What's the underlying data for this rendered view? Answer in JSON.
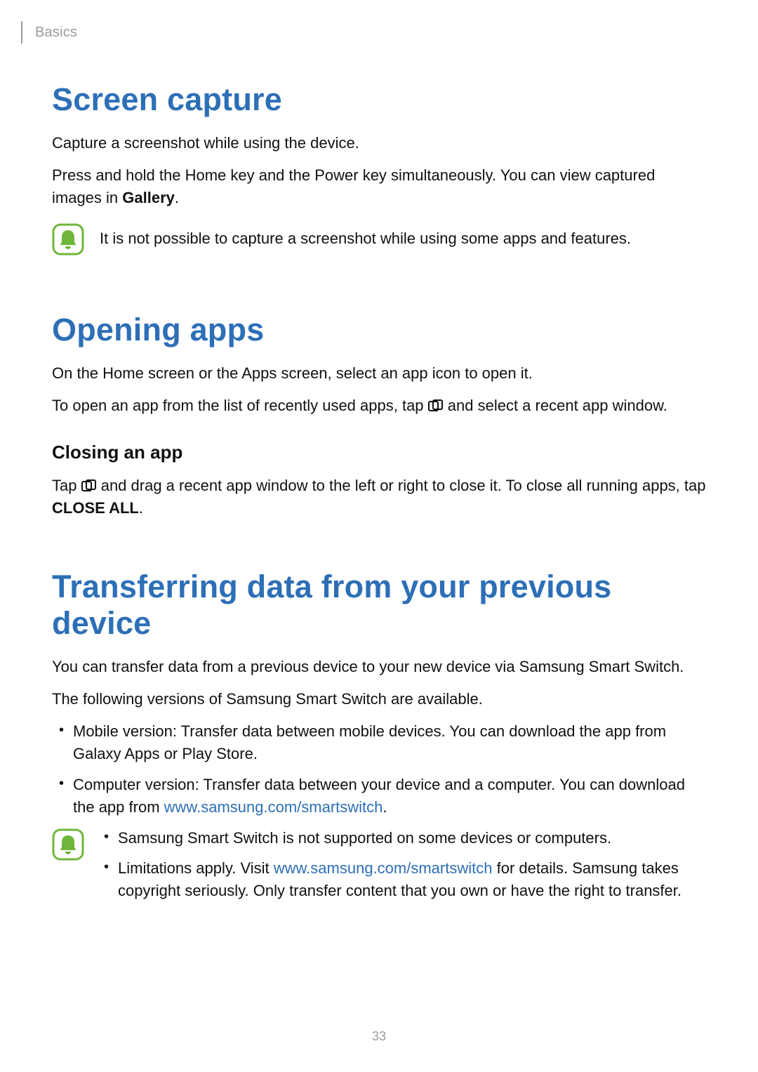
{
  "breadcrumb": "Basics",
  "page_number": "33",
  "section1": {
    "title": "Screen capture",
    "p1": "Capture a screenshot while using the device.",
    "p2_a": "Press and hold the Home key and the Power key simultaneously. You can view captured images in ",
    "p2_bold": "Gallery",
    "p2_b": ".",
    "note": "It is not possible to capture a screenshot while using some apps and features."
  },
  "section2": {
    "title": "Opening apps",
    "p1": "On the Home screen or the Apps screen, select an app icon to open it.",
    "p2_a": "To open an app from the list of recently used apps, tap ",
    "p2_b": " and select a recent app window.",
    "sub": "Closing an app",
    "p3_a": "Tap ",
    "p3_b": " and drag a recent app window to the left or right to close it. To close all running apps, tap ",
    "p3_bold": "CLOSE ALL",
    "p3_c": "."
  },
  "section3": {
    "title": "Transferring data from your previous device",
    "p1": "You can transfer data from a previous device to your new device via Samsung Smart Switch.",
    "p2": "The following versions of Samsung Smart Switch are available.",
    "bullet1_a": "Mobile version: Transfer data between mobile devices. You can download the app from ",
    "bullet1_bold1": "Galaxy Apps",
    "bullet1_mid": " or ",
    "bullet1_bold2": "Play Store",
    "bullet1_b": ".",
    "bullet2_a": "Computer version: Transfer data between your device and a computer. You can download the app from ",
    "bullet2_link": "www.samsung.com/smartswitch",
    "bullet2_b": ".",
    "note_bullet1": "Samsung Smart Switch is not supported on some devices or computers.",
    "note_bullet2_a": "Limitations apply. Visit ",
    "note_bullet2_link": "www.samsung.com/smartswitch",
    "note_bullet2_b": " for details. Samsung takes copyright seriously. Only transfer content that you own or have the right to transfer."
  }
}
